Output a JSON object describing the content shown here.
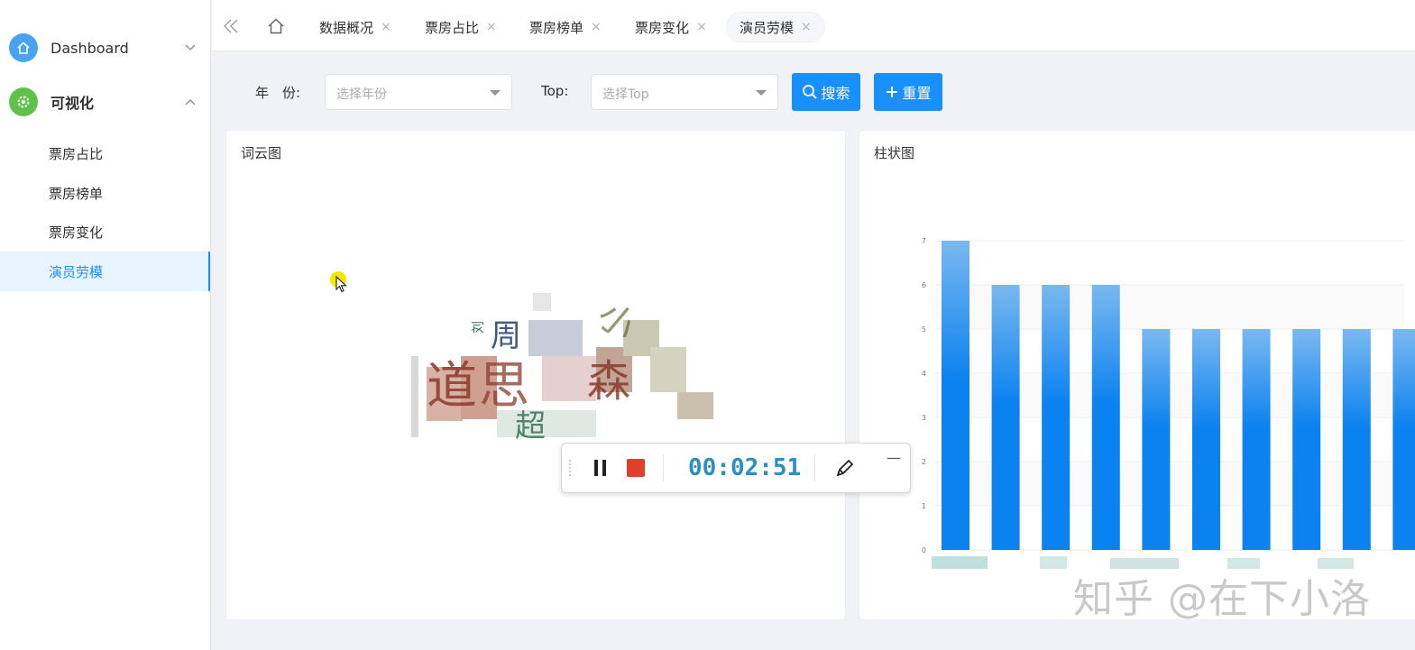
{
  "sidebar": {
    "dashboard": {
      "label": "Dashboard",
      "icon": "home-icon",
      "arrow": "chevron-down-icon"
    },
    "visual": {
      "label": "可视化",
      "icon": "gear-icon",
      "arrow": "chevron-up-icon"
    },
    "items": [
      {
        "label": "票房占比",
        "active": false
      },
      {
        "label": "票房榜单",
        "active": false
      },
      {
        "label": "票房变化",
        "active": false
      },
      {
        "label": "演员劳模",
        "active": true
      }
    ]
  },
  "tabs": [
    {
      "label": "数据概况",
      "close": "×"
    },
    {
      "label": "票房占比",
      "close": "×"
    },
    {
      "label": "票房榜单",
      "close": "×"
    },
    {
      "label": "票房变化",
      "close": "×"
    },
    {
      "label": "演员劳模",
      "close": "×",
      "active": true
    }
  ],
  "search": {
    "year_label": "年　份:",
    "year_placeholder": "选择年份",
    "top_label": "Top:",
    "top_placeholder": "选择Top",
    "search_button": "搜索",
    "reset_button": "重置"
  },
  "wordcloud": {
    "title": "词云图",
    "words": [
      {
        "text": "周",
        "color": "#3d5a80"
      },
      {
        "text": "道",
        "color": "#8b3a2a"
      },
      {
        "text": "思",
        "color": "#8b3a2a"
      },
      {
        "text": "森",
        "color": "#8b3a2a"
      },
      {
        "text": "超",
        "color": "#2e6b4f"
      },
      {
        "text": "小",
        "color": "#6b6b3a"
      },
      {
        "text": "刘",
        "color": "#2e6b4f"
      }
    ]
  },
  "barchart": {
    "title": "柱状图"
  },
  "chart_data": {
    "type": "bar",
    "title": "柱状图",
    "categories": [
      "",
      "",
      "",
      "",
      "",
      "",
      "",
      "",
      "",
      ""
    ],
    "values": [
      7,
      6,
      6,
      6,
      5,
      5,
      5,
      5,
      5,
      5
    ],
    "yticks": [
      "0",
      "1",
      "2",
      "3",
      "4",
      "5",
      "6",
      "7"
    ],
    "ylim": [
      0,
      7
    ],
    "grid": true,
    "bar_color_top": "#7ab8f0",
    "bar_color_bottom": "#0a82f0"
  },
  "recorder": {
    "time": "00:02:51",
    "pause_icon": "pause-icon",
    "stop_icon": "stop-icon",
    "pen_icon": "pen-icon",
    "minimize": "—"
  },
  "watermark": "知乎 @在下小洛",
  "colors": {
    "accent": "#1890ff",
    "active_bg": "#e8f4ff",
    "recorder_time": "#2a8fc2",
    "stop_red": "#e0402a"
  }
}
